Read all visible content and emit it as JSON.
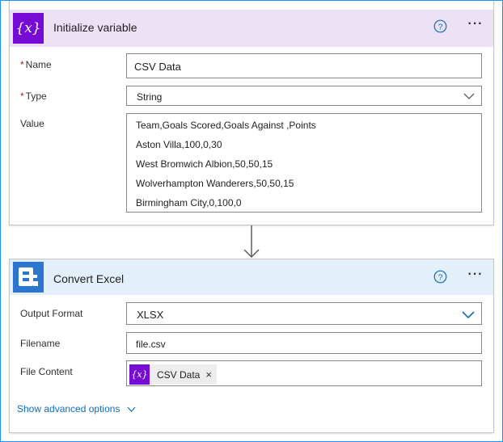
{
  "colors": {
    "variable_accent": "#770bd6",
    "variable_header_bg": "#ede1f6",
    "convert_accent": "#2c76d0",
    "convert_header_bg": "#e3effa",
    "link": "#0f6cbd",
    "required": "#a4262c"
  },
  "initialize_variable": {
    "title": "Initialize variable",
    "icon_text": "{x}",
    "icon": "variable-icon",
    "name_label": "Name",
    "name_value": "CSV Data",
    "type_label": "Type",
    "type_value": "String",
    "value_label": "Value",
    "value_lines": [
      "Team,Goals Scored,Goals Against ,Points",
      "Aston Villa,100,0,30",
      "West Bromwich Albion,50,50,15",
      "Wolverhampton Wanderers,50,50,15",
      "Birmingham City,0,100,0"
    ],
    "required_mark": "*",
    "more_glyph": "···"
  },
  "convert_excel": {
    "title": "Convert Excel",
    "icon": "encodian-logo-icon",
    "output_format_label": "Output Format",
    "output_format_value": "XLSX",
    "filename_label": "Filename",
    "filename_value": "file.csv",
    "file_content_label": "File Content",
    "file_content_token": {
      "icon_text": "{x}",
      "label": "CSV Data",
      "remove_glyph": "×"
    },
    "advanced_options": "Show advanced options",
    "more_glyph": "···"
  }
}
